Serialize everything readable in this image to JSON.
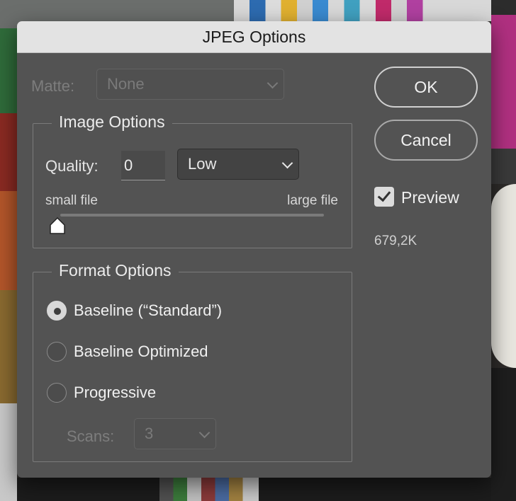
{
  "dialog": {
    "title": "JPEG Options",
    "matte": {
      "label": "Matte:",
      "value": "None",
      "enabled": false
    },
    "image_options": {
      "title": "Image Options",
      "quality_label": "Quality:",
      "quality_value": "0",
      "preset_value": "Low",
      "small_file_label": "small file",
      "large_file_label": "large file",
      "slider_fraction": 0.0
    },
    "format_options": {
      "title": "Format Options",
      "options": [
        {
          "label": "Baseline (“Standard”)",
          "selected": true
        },
        {
          "label": "Baseline Optimized",
          "selected": false
        },
        {
          "label": "Progressive",
          "selected": false
        }
      ],
      "scans_label": "Scans:",
      "scans_value": "3",
      "scans_enabled": false
    },
    "ok_label": "OK",
    "cancel_label": "Cancel",
    "preview_label": "Preview",
    "preview_checked": true,
    "file_size": "679,2K"
  },
  "colors": {
    "dialog_bg": "#535353",
    "titlebar_bg": "#e3e3e3",
    "text": "#e4e4e4",
    "disabled_text": "#7d7d7d"
  }
}
